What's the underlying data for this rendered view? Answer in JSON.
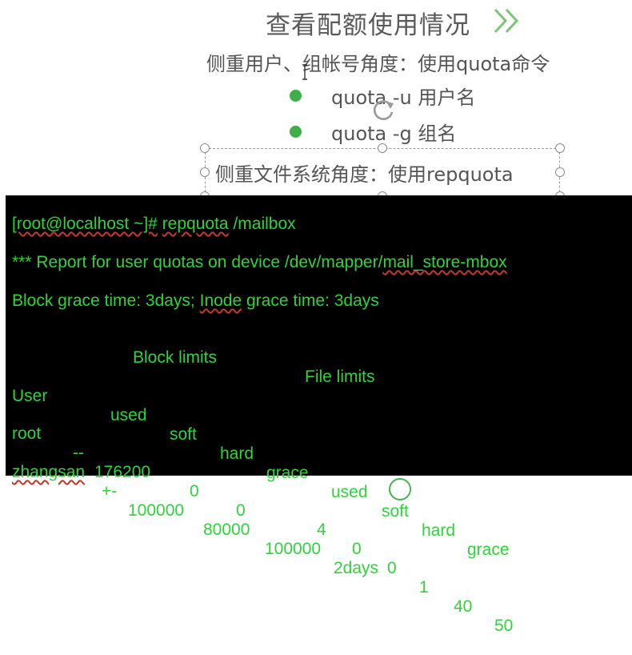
{
  "slide": {
    "title": "查看配额使用情况",
    "line1": "侧重用户、组帐号角度：使用quota命令",
    "bullets": [
      {
        "text": "quota -u 用户名"
      },
      {
        "text": "quota -g 组名"
      }
    ],
    "line_fs": "侧重文件系统角度：使用repquota"
  },
  "colors": {
    "accent": "#3fae49",
    "terminal_bg": "#000000",
    "terminal_text": "#2fd33a"
  },
  "terminal": {
    "prompt": "[root@localhost ~]#",
    "command": "repquota",
    "arg": "/mailbox",
    "report_prefix": "*** Report for user quotas on device /dev/mapper/",
    "report_device": "mail_store-mbox",
    "grace_a": "Block grace time: 3days; ",
    "grace_inode": "Inode",
    "grace_b": " grace time: 3days",
    "group_headers": [
      "Block limits",
      "File limits"
    ],
    "columns": [
      "User",
      "used",
      "soft",
      "hard",
      "grace",
      "used",
      "soft",
      "hard",
      "grace"
    ],
    "rows": [
      {
        "user": "root",
        "flag": "--",
        "cells": [
          "176200",
          "0",
          "0",
          "4",
          "0",
          "0"
        ]
      },
      {
        "user": "zhangsan",
        "flag": "+-",
        "cells": [
          "100000",
          "80000",
          "100000",
          "2days",
          "1",
          "40",
          "50"
        ]
      }
    ]
  }
}
